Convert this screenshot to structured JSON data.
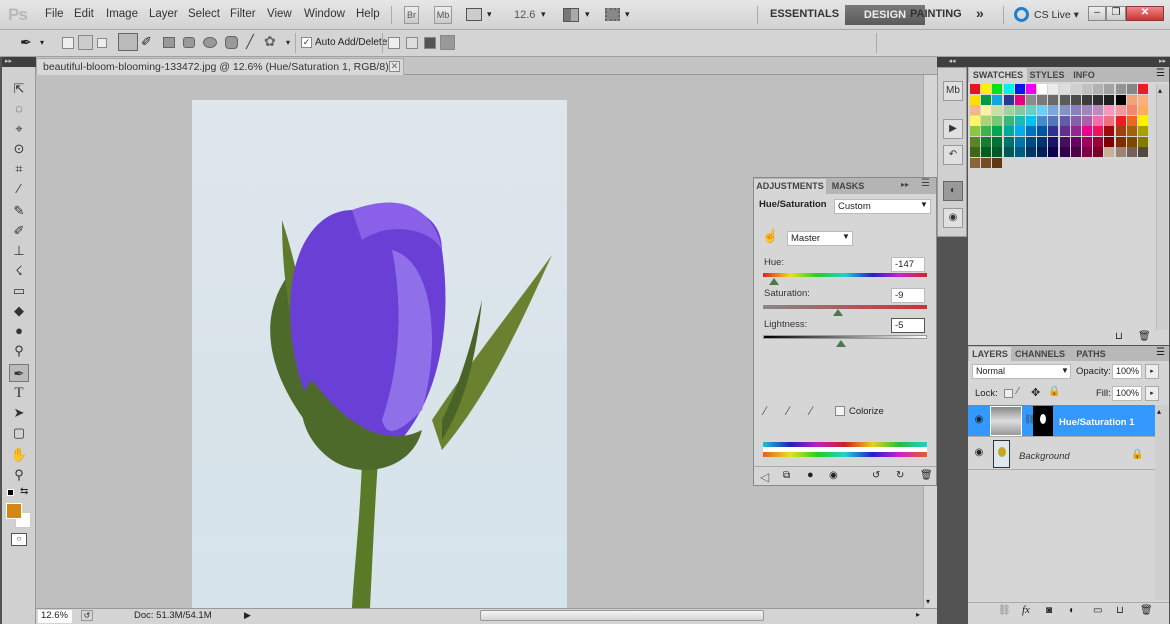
{
  "app": {
    "logo": "Ps"
  },
  "menu": [
    "File",
    "Edit",
    "Image",
    "Layer",
    "Select",
    "Filter",
    "View",
    "Window",
    "Help"
  ],
  "app_bar": {
    "bridge": "Br",
    "minibridge": "Mb",
    "zoom": "12.6",
    "zoom_arrow": "▾"
  },
  "workspaces": {
    "essentials": "ESSENTIALS",
    "design": "DESIGN",
    "painting": "PAINTING",
    "more": "»",
    "cs_live": "CS Live ▾"
  },
  "window_controls": {
    "minimize": "–",
    "restore": "❐",
    "close": "✕"
  },
  "options_bar": {
    "auto_add_delete_label": "Auto Add/Delete",
    "auto_add_delete_checked": true
  },
  "document": {
    "tab_title": "beautiful-bloom-blooming-133472.jpg @ 12.6% (Hue/Saturation 1, RGB/8) *",
    "close": "✕"
  },
  "tools": [
    "⇱",
    "◌",
    "⌖",
    "⊙",
    "⌗",
    "⁄",
    "✎",
    "✐",
    "⊥",
    "☇",
    "▭",
    "◆",
    "●",
    "⚲",
    "✒",
    "T",
    "➤",
    "▢",
    "✋",
    "⚲"
  ],
  "colors": {
    "foreground": "#d08a12",
    "background": "#ffffff",
    "accent": "#3399ff"
  },
  "status": {
    "zoom": "12.6%",
    "doc": "Doc: 51.3M/54.1M",
    "arrow": "▶"
  },
  "adjustments": {
    "tabs": [
      "ADJUSTMENTS",
      "MASKS"
    ],
    "type_label": "Hue/Saturation",
    "preset": "Custom",
    "channel": "Master",
    "hue": {
      "label": "Hue:",
      "value": "-147"
    },
    "saturation": {
      "label": "Saturation:",
      "value": "-9"
    },
    "lightness": {
      "label": "Lightness:",
      "value": "-5"
    },
    "colorize_label": "Colorize",
    "colorize_checked": false
  },
  "swatches": {
    "tabs": [
      "SWATCHES",
      "STYLES",
      "INFO"
    ],
    "rows": [
      [
        "#e8141c",
        "#fff200",
        "#00e21e",
        "#00f0f0",
        "#0018e8",
        "#ee00ee",
        "#ffffff",
        "#ebebeb",
        "#dedede",
        "#cfcfcf",
        "#c0c0c0",
        "#b2b2b2",
        "#a3a3a3",
        "#949494",
        "#868686",
        "#e81e28"
      ],
      [
        "#ffe000",
        "#009a46",
        "#13a4e3",
        "#2c3894",
        "#e4007f",
        "#8c8c8c",
        "#7a7a7a",
        "#6a6a6a",
        "#5b5b5b",
        "#4c4c4c",
        "#3d3d3d",
        "#2e2e2e",
        "#1f1f1f",
        "#000000",
        "#f4a07a",
        "#f8b07c"
      ],
      [
        "#f7b58b",
        "#fbf2a4",
        "#c7e29f",
        "#a3d39c",
        "#7fcca3",
        "#6ccdc6",
        "#6dcff6",
        "#7da7d9",
        "#8393ca",
        "#8781bd",
        "#a186be",
        "#bd8cbf",
        "#f49ac1",
        "#f5989d",
        "#f6876e",
        "#fbaf5d"
      ],
      [
        "#fff568",
        "#acd373",
        "#7cc576",
        "#3bb878",
        "#1abbb4",
        "#00bff3",
        "#438ccb",
        "#5574b9",
        "#605ca8",
        "#8560a8",
        "#a863a8",
        "#f06eaa",
        "#f26d7d",
        "#ed1c24",
        "#f26522",
        "#fff200"
      ],
      [
        "#8dc63f",
        "#39b54a",
        "#00a651",
        "#00a99d",
        "#00aeef",
        "#0072bc",
        "#0054a6",
        "#2e3192",
        "#662d91",
        "#92278f",
        "#ec008c",
        "#ed145b",
        "#9e0b0f",
        "#a0410d",
        "#a36209",
        "#aba000"
      ],
      [
        "#598527",
        "#197b30",
        "#007236",
        "#00746b",
        "#0076a3",
        "#004a80",
        "#003471",
        "#1b1464",
        "#440e62",
        "#630460",
        "#9e005d",
        "#9e0039",
        "#790000",
        "#7b2e00",
        "#7d4900",
        "#827b00"
      ],
      [
        "#406618",
        "#005e20",
        "#005826",
        "#005952",
        "#005b7f",
        "#003663",
        "#002157",
        "#0d004c",
        "#32004b",
        "#4b0049",
        "#7b0046",
        "#7a0026",
        "#c7b299",
        "#998675",
        "#736357",
        "#534741"
      ],
      [
        "#8c6239",
        "#754c24",
        "#603913"
      ]
    ],
    "extra_row6": [
      "#37302d",
      "#c69c6d",
      "#a67c52"
    ]
  },
  "layers": {
    "tabs": [
      "LAYERS",
      "CHANNELS",
      "PATHS"
    ],
    "blend_mode": "Normal",
    "opacity_label": "Opacity:",
    "opacity": "100%",
    "lock_label": "Lock:",
    "fill_label": "Fill:",
    "fill": "100%",
    "items": [
      {
        "name": "Hue/Saturation 1",
        "selected": true,
        "visible": true
      },
      {
        "name": "Background",
        "selected": false,
        "visible": true,
        "locked": true
      }
    ],
    "footer_icons": [
      "link-icon",
      "fx-icon",
      "mask-icon",
      "adjustment-icon",
      "folder-icon",
      "new-layer-icon",
      "trash-icon"
    ]
  }
}
